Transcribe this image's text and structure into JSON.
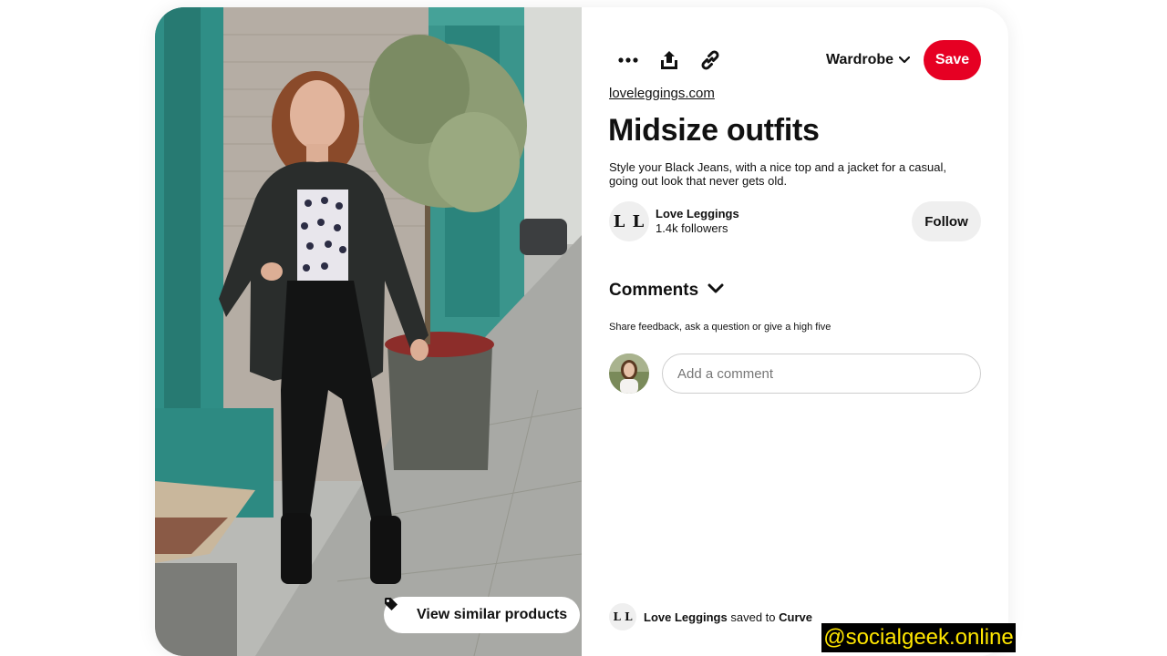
{
  "toolbar": {
    "more_icon": "ellipsis-icon",
    "share_icon": "share-upload-icon",
    "link_icon": "link-chain-icon",
    "board_name": "Wardrobe",
    "board_chevron_icon": "chevron-down-icon",
    "save_label": "Save"
  },
  "pin": {
    "source": "loveleggings.com",
    "title": "Midsize outfits",
    "description": "Style your Black Jeans, with a nice top and a jacket for a casual, going out look that never gets old."
  },
  "creator": {
    "avatar_text": "L L",
    "name": "Love Leggings",
    "followers": "1.4k followers",
    "follow_label": "Follow"
  },
  "comments": {
    "title": "Comments",
    "hint": "Share feedback, ask a question or give a high five",
    "placeholder": "Add a comment"
  },
  "image": {
    "similar_label": "View similar products",
    "tag_icon": "tag-icon"
  },
  "saved_by": {
    "avatar_text": "L L",
    "user": "Love Leggings",
    "middle": "saved to",
    "board": "Curve"
  },
  "watermark": "@socialgeek.online",
  "colors": {
    "save_red": "#e60023",
    "button_grey": "#efefef",
    "watermark_text": "#ffe600"
  }
}
